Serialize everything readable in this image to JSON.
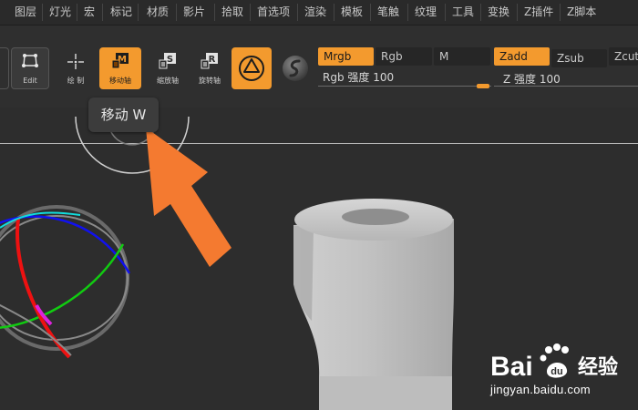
{
  "menu": {
    "items": [
      "图层",
      "灯光",
      "宏",
      "标记",
      "材质",
      "影片",
      "拾取",
      "首选项",
      "渲染",
      "模板",
      "笔触",
      "纹理",
      "工具",
      "变换",
      "Z插件",
      "Z脚本"
    ]
  },
  "toolbar": {
    "edit_label": "Edit",
    "draw_label": "绘 制",
    "move_label": "移动轴",
    "scale_label": "缩放轴",
    "rotate_label": "旋转轴",
    "modes": {
      "mrgb": "Mrgb",
      "rgb": "Rgb",
      "m": "M",
      "zadd": "Zadd",
      "zsub": "Zsub",
      "zcut": "Zcut"
    },
    "rgb_intensity_label": "Rgb 强度 100",
    "rgb_intensity_value": 100,
    "z_intensity_label": "Z 强度 100",
    "z_intensity_value": 100
  },
  "tooltip": {
    "text": "移动 W"
  },
  "watermark": {
    "brand": "Baidu 经验",
    "url": "jingyan.baidu.com"
  },
  "colors": {
    "accent": "#f39a2e",
    "arrow": "#f47a30"
  },
  "icons": {
    "edit": "edit-icon",
    "draw": "draw-crosshair-icon",
    "move": "move-icon",
    "scale": "scale-icon",
    "rotate": "rotate-icon",
    "material": "material-sphere-icon",
    "gyro": "transpose-gyro-icon"
  }
}
